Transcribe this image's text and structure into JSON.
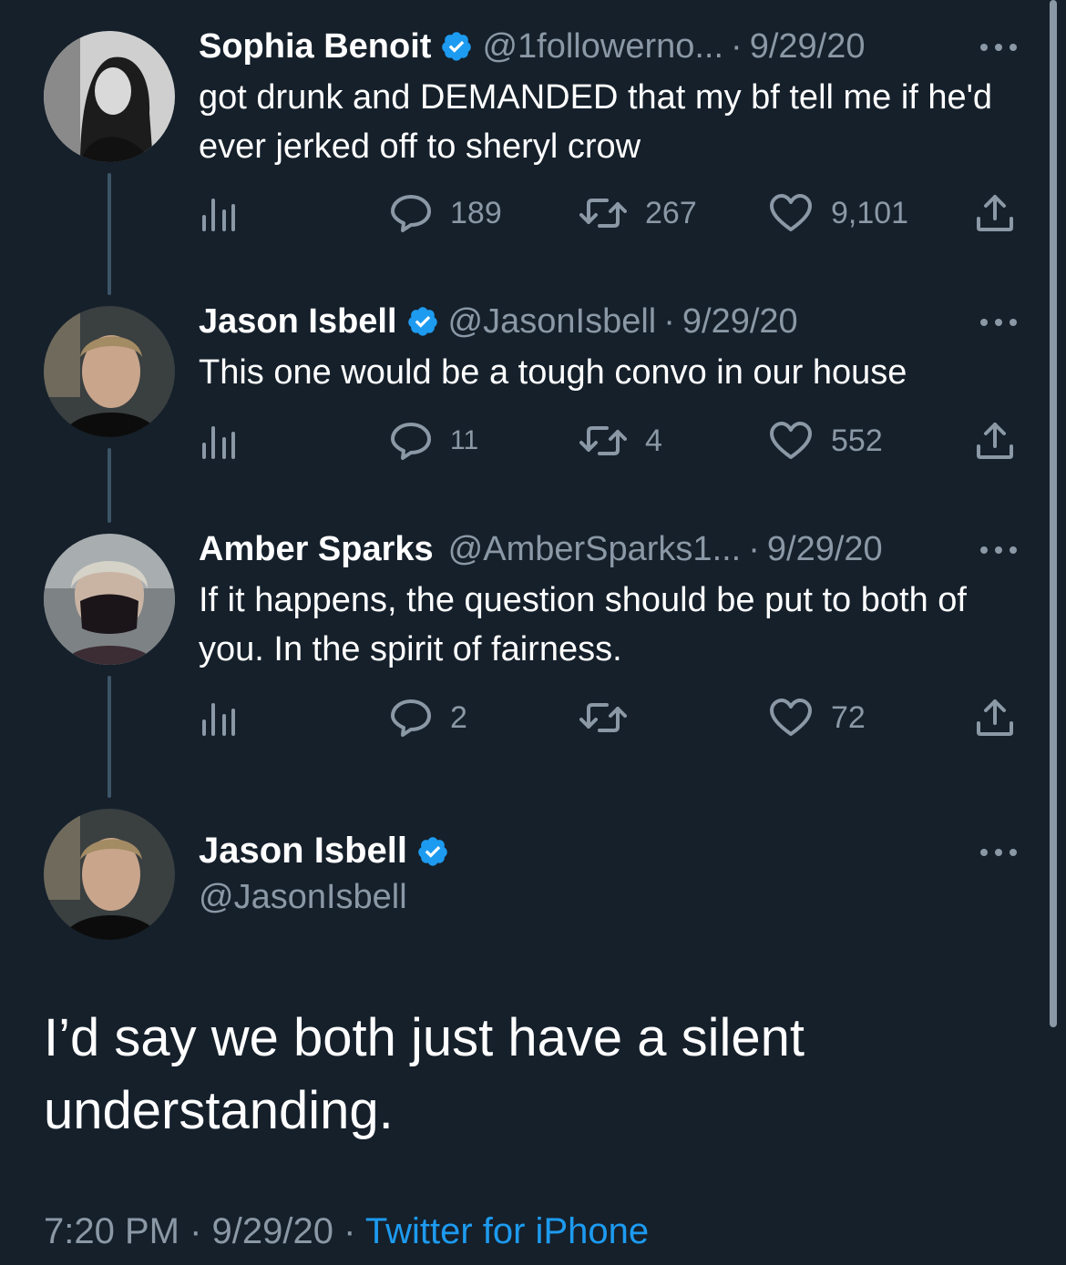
{
  "colors": {
    "background": "#15202b",
    "muted": "#8b98a5",
    "accent": "#1d9bf0",
    "verified": "#1d9bf0"
  },
  "tweets": [
    {
      "name": "Sophia Benoit",
      "handle": "@1followerno...",
      "sep": "·",
      "date": "9/29/20",
      "text": "got drunk and DEMANDED that my bf tell me if he'd ever jerked off to sheryl crow",
      "replies": "189",
      "retweets": "267",
      "likes": "9,101"
    },
    {
      "name": "Jason Isbell",
      "handle": "@JasonIsbell",
      "sep": "·",
      "date": "9/29/20",
      "text": "This one would be a tough convo in our house",
      "replies": "11",
      "retweets": "4",
      "likes": "552"
    },
    {
      "name": "Amber Sparks",
      "handle": "@AmberSparks1...",
      "sep": "·",
      "date": "9/29/20",
      "text": "If it happens, the question should be put to both of you. In the spirit of fairness.",
      "replies": "2",
      "retweets": "",
      "likes": "72"
    }
  ],
  "main": {
    "name": "Jason Isbell",
    "handle": "@JasonIsbell",
    "text": "I’d say we both just have a silent understanding.",
    "time": "7:20 PM",
    "sep1": "·",
    "date": "9/29/20",
    "sep2": "·",
    "source": "Twitter for iPhone"
  },
  "icons": [
    "verified-badge-icon",
    "more-icon",
    "analytics-icon",
    "reply-icon",
    "retweet-icon",
    "like-icon",
    "share-icon"
  ]
}
